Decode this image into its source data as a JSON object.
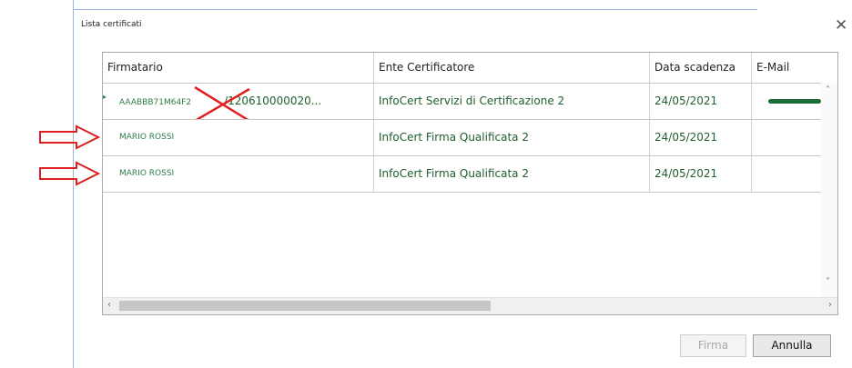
{
  "window": {
    "title": "Lista certificati",
    "close_icon": "close-icon"
  },
  "table": {
    "headers": [
      "Firmatario",
      "Ente Certificatore",
      "Data scadenza",
      "E-Mail"
    ],
    "rows": [
      {
        "firmatario": "AAABBB71M64F2",
        "firmatario_suffix": "/120610000020...",
        "ente": "InfoCert Servizi di Certificazione 2",
        "scadenza": "24/05/2021",
        "email": ""
      },
      {
        "firmatario": "MARIO ROSSI",
        "ente": "InfoCert Firma Qualificata 2",
        "scadenza": "24/05/2021",
        "email": ""
      },
      {
        "firmatario": "MARIO ROSSI",
        "ente": "InfoCert Firma Qualificata 2",
        "scadenza": "24/05/2021",
        "email": ""
      }
    ]
  },
  "buttons": {
    "firma": "Firma",
    "annulla": "Annulla"
  },
  "colors": {
    "annotation": "#e02020",
    "row_text": "#1e5e2e",
    "email_redaction": "#1f6b38"
  }
}
